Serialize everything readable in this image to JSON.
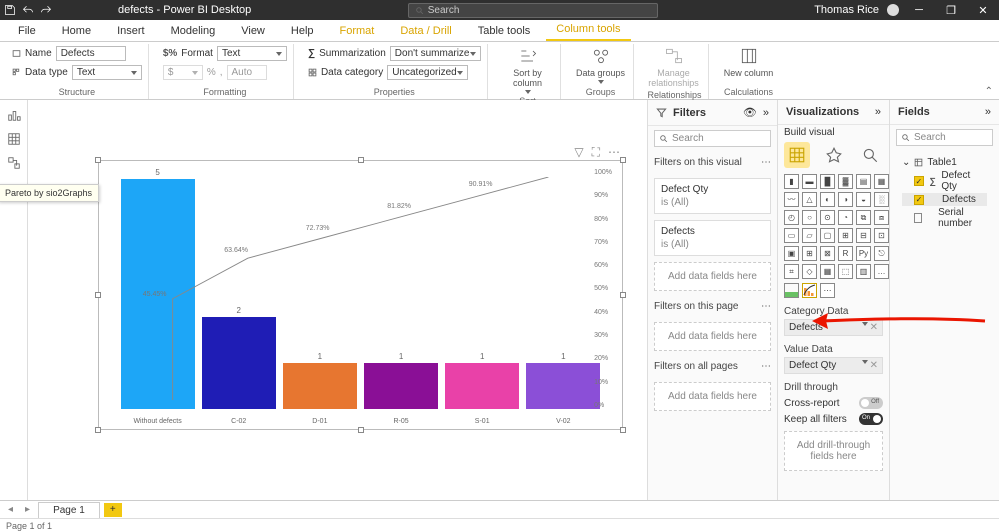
{
  "titlebar": {
    "doc_title": "defects - Power BI Desktop",
    "search_placeholder": "Search",
    "user": "Thomas Rice"
  },
  "ribbon_tabs": [
    "File",
    "Home",
    "Insert",
    "Modeling",
    "View",
    "Help",
    "Format",
    "Data / Drill",
    "Table tools",
    "Column tools"
  ],
  "ribbon_tabs_active": 9,
  "ribbon": {
    "structure": {
      "name_label": "Name",
      "name_value": "Defects",
      "datatype_label": "Data type",
      "datatype_value": "Text",
      "group": "Structure"
    },
    "formatting": {
      "format_label": "Format",
      "format_value": "Text",
      "currency": "$",
      "percent": "%",
      "comma": ",",
      "auto": "Auto",
      "group": "Formatting"
    },
    "properties": {
      "summ_label": "Summarization",
      "summ_value": "Don't summarize",
      "cat_label": "Data category",
      "cat_value": "Uncategorized",
      "group": "Properties"
    },
    "sort": {
      "btn": "Sort by column",
      "group": "Sort"
    },
    "groups": {
      "btn": "Data groups",
      "group": "Groups"
    },
    "relationships": {
      "btn": "Manage relationships",
      "group": "Relationships"
    },
    "calculations": {
      "btn": "New column",
      "group": "Calculations"
    }
  },
  "filters": {
    "title": "Filters",
    "search": "Search",
    "sections": {
      "visual": "Filters on this visual",
      "page": "Filters on this page",
      "all": "Filters on all pages"
    },
    "cards": {
      "qty": {
        "name": "Defect Qty",
        "state": "is (All)"
      },
      "def": {
        "name": "Defects",
        "state": "is (All)"
      }
    },
    "drop": "Add data fields here"
  },
  "viz": {
    "title": "Visualizations",
    "build": "Build visual",
    "tooltip": "Pareto by sio2Graphs",
    "category_label": "Category Data",
    "category_val": "Defects",
    "value_label": "Value Data",
    "value_val": "Defect Qty",
    "drill_label": "Drill through",
    "cross": "Cross-report",
    "cross_state": "Off",
    "keep": "Keep all filters",
    "keep_state": "On",
    "drill_drop": "Add drill-through fields here"
  },
  "fields": {
    "title": "Fields",
    "search": "Search",
    "table": "Table1",
    "items": [
      {
        "name": "Defect Qty",
        "checked": true,
        "sigma": true
      },
      {
        "name": "Defects",
        "checked": true,
        "sigma": false,
        "sel": true
      },
      {
        "name": "Serial number",
        "checked": false,
        "sigma": false
      }
    ]
  },
  "pages": {
    "p1": "Page 1",
    "status": "Page 1 of 1"
  },
  "chart_data": {
    "type": "bar",
    "categories": [
      "Without defects",
      "C-02",
      "D-01",
      "R-05",
      "S-01",
      "V-02"
    ],
    "values": [
      5,
      2,
      1,
      1,
      1,
      1
    ],
    "colors": [
      "#1da6f7",
      "#1f1db5",
      "#e77630",
      "#8a0f96",
      "#e941a8",
      "#8b4fd7"
    ],
    "cum_percent": [
      45.45,
      63.64,
      72.73,
      81.82,
      90.91,
      100
    ],
    "cum_labels": [
      "45.45%",
      "63.64%",
      "72.73%",
      "81.82%",
      "90.91%",
      ""
    ],
    "y2_ticks": [
      "100%",
      "90%",
      "80%",
      "70%",
      "60%",
      "50%",
      "40%",
      "30%",
      "20%",
      "10%",
      "0%"
    ],
    "y_max": 5
  }
}
